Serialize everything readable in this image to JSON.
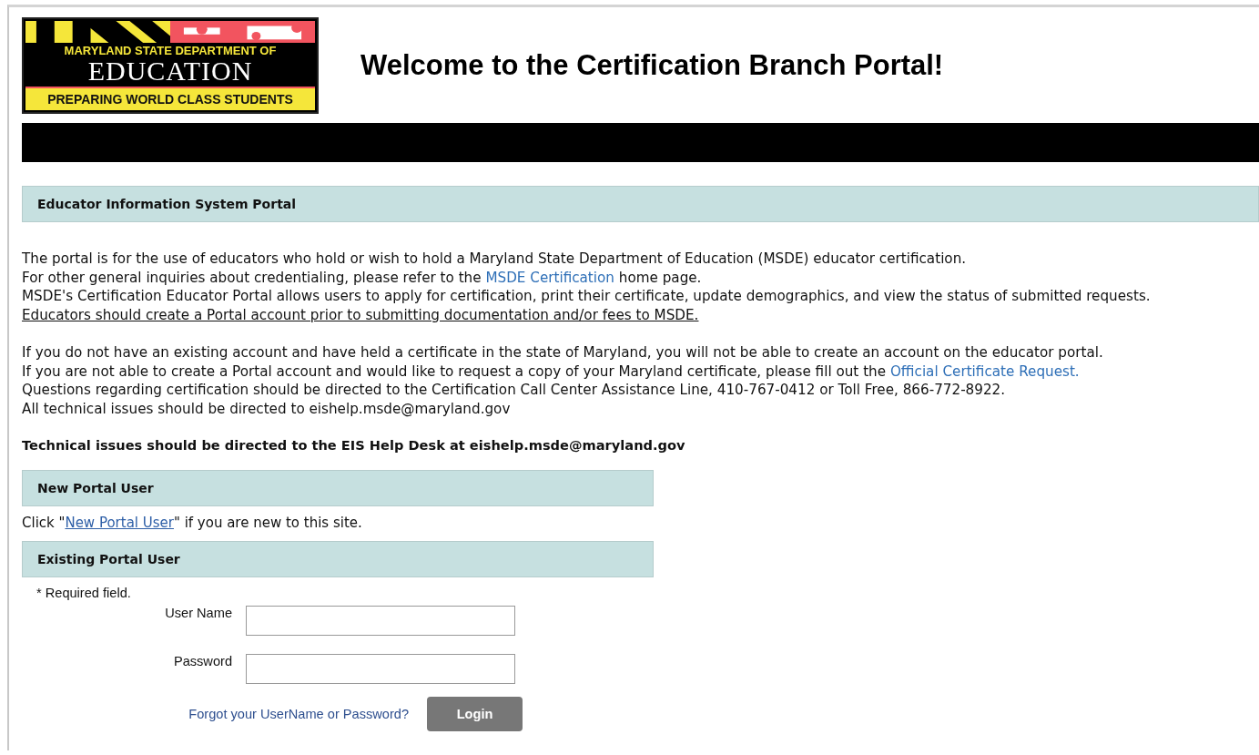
{
  "logo": {
    "top_line": "MARYLAND STATE DEPARTMENT OF",
    "main": "EDUCATION",
    "tagline": "PREPARING WORLD CLASS STUDENTS"
  },
  "title": "Welcome to the Certification Branch Portal!",
  "portal_header": "Educator Information System Portal",
  "paragraphs": [
    [
      {
        "before": "The portal is for the use of educators who hold or wish to hold a Maryland State Department of Education (MSDE) educator certification.",
        "underline": false
      },
      {
        "before": "For other general inquiries about credentialing, please refer to the ",
        "link": "MSDE Certification",
        "after": " home page.",
        "underline": false
      },
      {
        "before": "MSDE's Certification Educator Portal allows users to apply for certification, print their certificate, update demographics, and view the status of submitted requests.",
        "underline": false
      },
      {
        "before": "Educators should create a Portal account prior to submitting documentation and/or fees to MSDE.",
        "underline": true
      }
    ],
    [
      {
        "before": "If you do not have an existing account and have held a certificate in the state of Maryland, you will not be able to create an account on the educator portal.",
        "underline": false
      },
      {
        "before": "If you are not able to create a Portal account and would like to request a copy of your Maryland certificate, please fill out the ",
        "link": "Official Certificate Request.",
        "underline": false
      },
      {
        "before": "Questions regarding certification should be directed to the Certification Call Center Assistance Line, 410-767-0412 or Toll Free, 866-772-8922.",
        "underline": false
      },
      {
        "before": "All technical issues should be directed to eishelp.msde@maryland.gov",
        "underline": false
      }
    ]
  ],
  "notice": "Technical issues should be directed to the EIS Help Desk at eishelp.msde@maryland.gov",
  "new_user": {
    "header": "New Portal User",
    "before": "Click \"",
    "link": "New Portal User",
    "after": "\" if you are new to this site."
  },
  "existing_user": {
    "header": "Existing Portal User",
    "required_note": "* Required field.",
    "fields": [
      {
        "label": "User Name"
      },
      {
        "label": "Password"
      }
    ],
    "forgot_link": "Forgot your UserName or Password?",
    "login_button": "Login"
  }
}
